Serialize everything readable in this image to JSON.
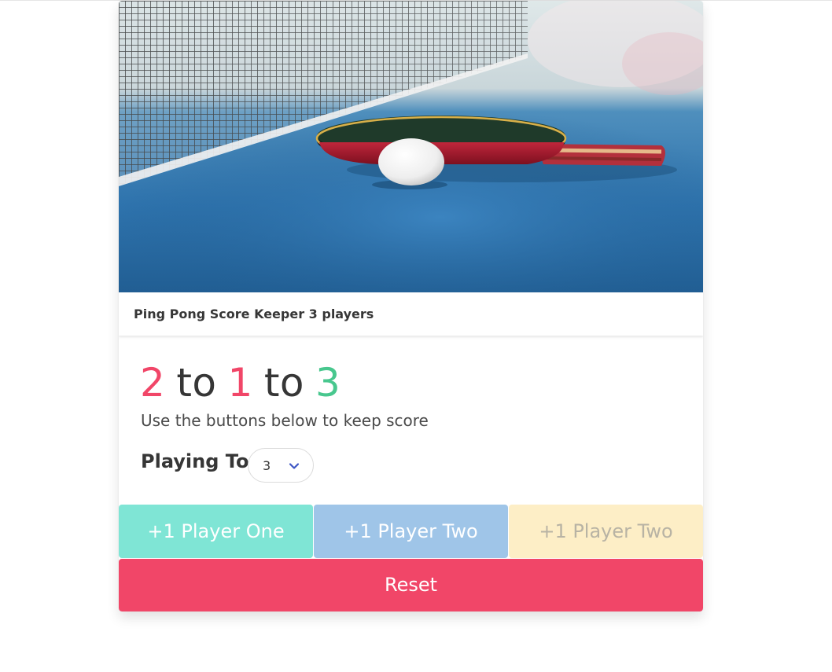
{
  "header": {
    "title": "Ping Pong Score Keeper 3 players"
  },
  "scoreboard": {
    "player_one_score": "2",
    "player_two_score": "1",
    "player_three_score": "3",
    "separator": "to",
    "subtitle": "Use the buttons below to keep score",
    "colors": {
      "player_one": "#f14668",
      "player_two": "#f14668",
      "player_three": "#48c78e",
      "text": "#363636"
    }
  },
  "settings": {
    "playing_to_label": "Playing To",
    "playing_to_value": "3"
  },
  "buttons": {
    "player_one_label": "+1 Player One",
    "player_two_label": "+1 Player Two",
    "player_three_label": "+1 Player Two",
    "reset_label": "Reset",
    "colors": {
      "player_one": "#7fe5d5",
      "player_two": "#9fc5e8",
      "player_three": "#fdeec6",
      "reset": "#f14668"
    }
  },
  "icons": {
    "select_arrow": "chevron-down-icon"
  }
}
